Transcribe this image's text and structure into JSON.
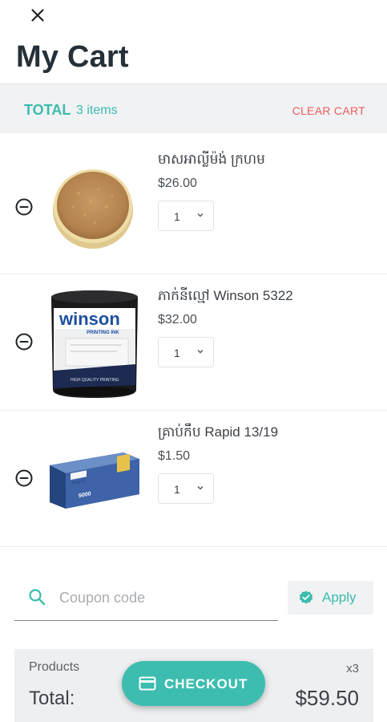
{
  "header": {
    "title": "My Cart",
    "close_icon": "close-icon"
  },
  "summary": {
    "total_label": "TOTAL",
    "items_count": "3 items",
    "clear_label": "CLEAR CART",
    "accent_color": "#3bbcae",
    "clear_color": "#ef5a5f"
  },
  "items": [
    {
      "name": "មាសអាល្លីម៉ង់ ក្រហម",
      "price": "$26.00",
      "quantity": "1",
      "image": "gold-powder-tin"
    },
    {
      "name": "ភាក់នីល្មៅ Winson 5322",
      "price": "$32.00",
      "quantity": "1",
      "image": "winson-ink-tub"
    },
    {
      "name": "គ្រាប់កឹប Rapid 13/19",
      "price": "$1.50",
      "quantity": "1",
      "image": "rapid-staples-box"
    }
  ],
  "coupon": {
    "placeholder": "Coupon code",
    "apply_label": "Apply"
  },
  "totals": {
    "products_label": "Products",
    "products_count": "x3",
    "total_label": "Total:",
    "total_value": "$59.50"
  },
  "checkout": {
    "label": "CHECKOUT",
    "color": "#3dbdb0"
  }
}
